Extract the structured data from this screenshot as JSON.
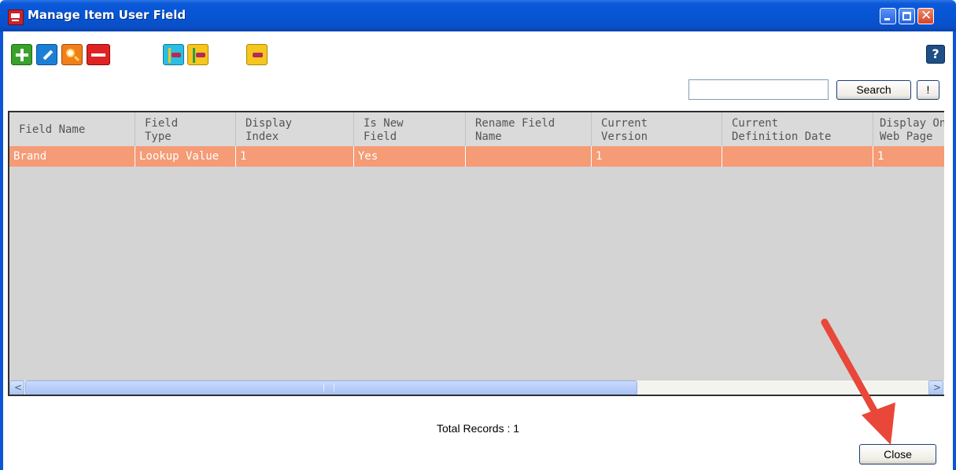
{
  "window": {
    "title": "Manage Item User Field"
  },
  "toolbar": {
    "icons": [
      "add-icon",
      "edit-icon",
      "find-icon",
      "delete-icon",
      "move-left-icon",
      "move-right-icon",
      "move-icon",
      "help-icon"
    ],
    "help_label": "?"
  },
  "search": {
    "value": "",
    "button_label": "Search",
    "bang_label": "!"
  },
  "grid": {
    "headers": [
      {
        "line1": "Field Name",
        "line2": ""
      },
      {
        "line1": "Field",
        "line2": "Type"
      },
      {
        "line1": "Display",
        "line2": "Index"
      },
      {
        "line1": "Is New",
        "line2": "Field"
      },
      {
        "line1": "Rename Field",
        "line2": "Name"
      },
      {
        "line1": "Current",
        "line2": "Version"
      },
      {
        "line1": "Current",
        "line2": "Definition Date"
      },
      {
        "line1": "Display On",
        "line2": "Web Page"
      }
    ],
    "rows": [
      [
        "Brand",
        "Lookup Value",
        "1",
        "Yes",
        "",
        "1",
        "",
        "1"
      ]
    ],
    "row_highlight_color": "#f59b76"
  },
  "footer": {
    "total_records": "Total Records : 1",
    "close_label": "Close"
  },
  "colors": {
    "titlebar": "#0655d3",
    "arrow": "#e8473a"
  }
}
